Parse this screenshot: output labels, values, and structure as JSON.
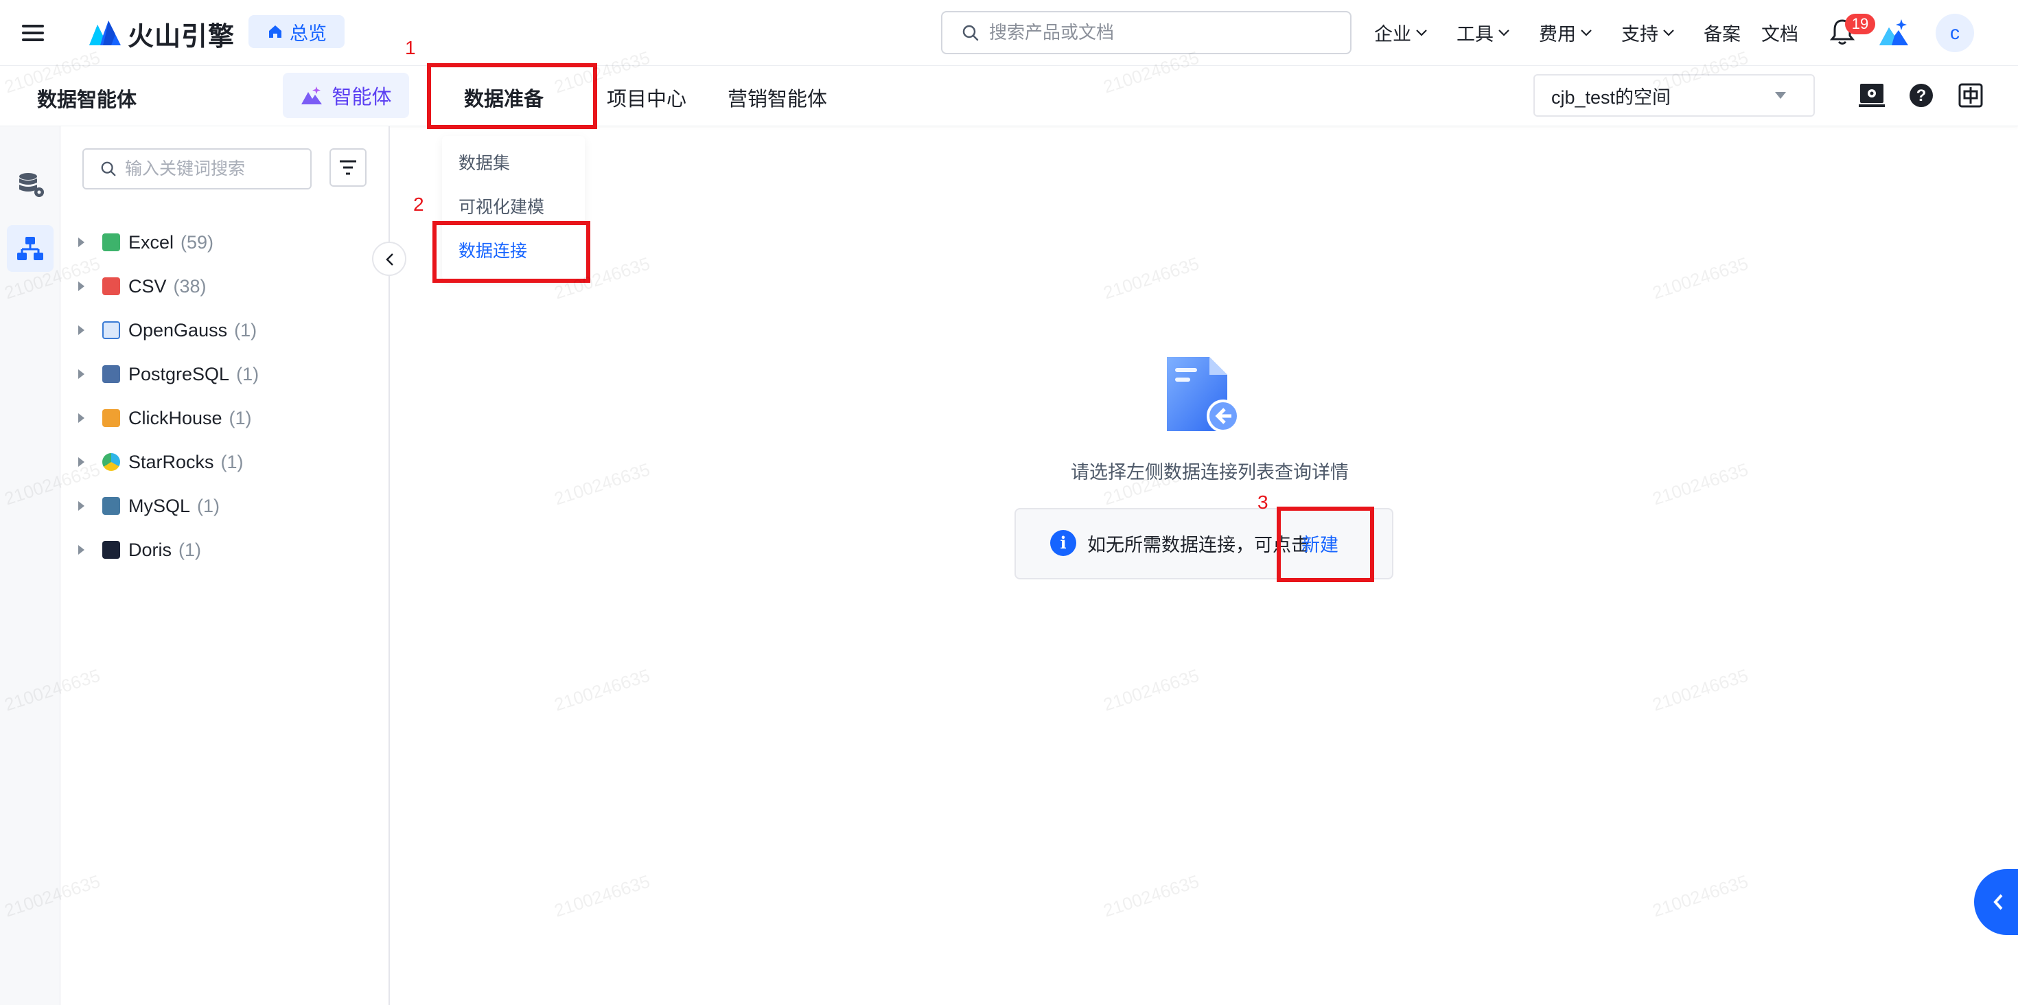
{
  "topbar": {
    "brand": "火山引擎",
    "home_label": "总览",
    "search_placeholder": "搜索产品或文档",
    "nav": [
      {
        "label": "企业",
        "dropdown": true
      },
      {
        "label": "工具",
        "dropdown": true
      },
      {
        "label": "费用",
        "dropdown": true
      },
      {
        "label": "支持",
        "dropdown": true
      },
      {
        "label": "备案",
        "dropdown": false
      },
      {
        "label": "文档",
        "dropdown": false
      }
    ],
    "notification_count": "19",
    "avatar_letter": "c"
  },
  "subbar": {
    "product_title": "数据智能体",
    "tabs": [
      {
        "label": "智能体"
      },
      {
        "label": "数据准备",
        "active": true
      },
      {
        "label": "项目中心"
      },
      {
        "label": "营销智能体"
      }
    ],
    "space_selector": "cjb_test的空间"
  },
  "dropdown": {
    "items": [
      {
        "label": "数据集"
      },
      {
        "label": "可视化建模"
      },
      {
        "label": "数据连接",
        "active": true
      }
    ]
  },
  "tree": {
    "search_placeholder": "输入关键词搜索",
    "items": [
      {
        "name": "Excel",
        "count": "(59)",
        "color": "#3db36b"
      },
      {
        "name": "CSV",
        "count": "(38)",
        "color": "#e8504b"
      },
      {
        "name": "OpenGauss",
        "count": "(1)",
        "color": "#3a7bd5"
      },
      {
        "name": "PostgreSQL",
        "count": "(1)",
        "color": "#4a6fa5"
      },
      {
        "name": "ClickHouse",
        "count": "(1)",
        "color": "#f0a030"
      },
      {
        "name": "StarRocks",
        "count": "(1)",
        "color": "#2fb5e8"
      },
      {
        "name": "MySQL",
        "count": "(1)",
        "color": "#4479a1"
      },
      {
        "name": "Doris",
        "count": "(1)",
        "color": "#1a2236"
      }
    ]
  },
  "empty_state": {
    "message": "请选择左侧数据连接列表查询详情",
    "hint": "如无所需数据连接，可点击",
    "link": "新建"
  },
  "annotations": [
    "1",
    "2",
    "3"
  ],
  "watermark": "2100246635",
  "colors": {
    "accent": "#1664ff",
    "annotation_red": "#e8141a",
    "agent_purple": "#5b3ff2"
  }
}
